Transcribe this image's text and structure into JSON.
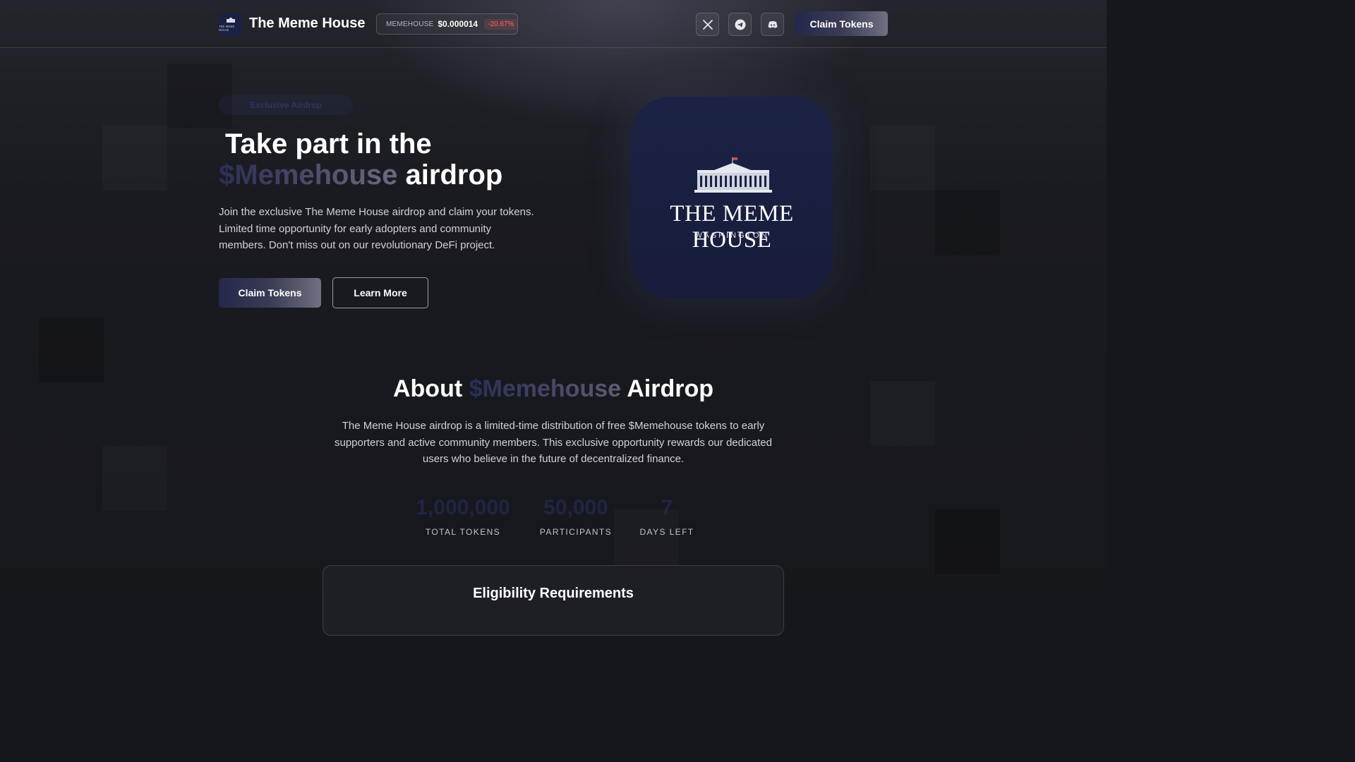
{
  "header": {
    "brand": "The Meme House",
    "logo_text": "THE MEME HOUSE",
    "ticker": {
      "symbol": "MEMEHOUSE",
      "price": "$0.000014",
      "change": "-20.67%",
      "change_color": "#f06a6a"
    },
    "socials": [
      {
        "icon": "x-icon"
      },
      {
        "icon": "telegram-icon"
      },
      {
        "icon": "discord-icon"
      }
    ],
    "claim_label": "Claim Tokens"
  },
  "hero": {
    "badge": "Exclusive Airdrop",
    "title_line1": "Take part in the",
    "title_highlight": "$Memehouse",
    "title_line2_rest": "airdrop",
    "description": "Join the exclusive The Meme House airdrop and claim your tokens. Limited time opportunity for early adopters and community members. Don't miss out on our revolutionary DeFi project.",
    "primary_cta": "Claim Tokens",
    "secondary_cta": "Learn More",
    "logo_title": "THE MEME HOUSE",
    "logo_subtitle": "WASHINGTON"
  },
  "about": {
    "title_prefix": "About",
    "title_highlight": "$Memehouse",
    "title_suffix": "Airdrop",
    "description": "The Meme House airdrop is a limited-time distribution of free $Memehouse tokens to early supporters and active community members. This exclusive opportunity rewards our dedicated users who believe in the future of decentralized finance.",
    "stats": [
      {
        "value": "1,000,000",
        "label": "TOTAL TOKENS"
      },
      {
        "value": "50,000",
        "label": "PARTICIPANTS"
      },
      {
        "value": "7",
        "label": "DAYS LEFT"
      }
    ]
  },
  "eligibility": {
    "title": "Eligibility Requirements"
  },
  "colors": {
    "accent_navy": "#1b2245",
    "background": "#16171c"
  }
}
